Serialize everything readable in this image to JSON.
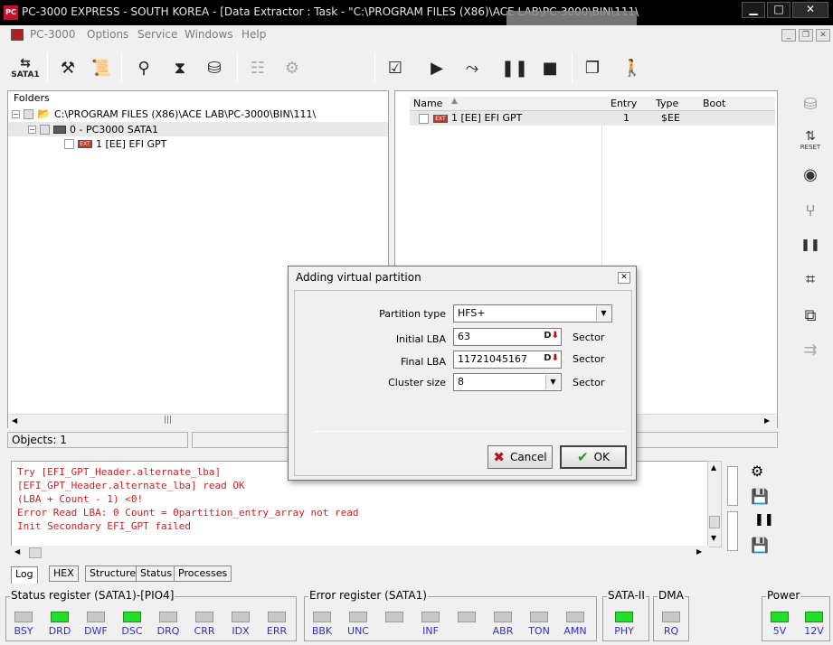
{
  "window": {
    "title": "PC-3000 EXPRESS - SOUTH KOREA - [Data Extractor : Task - \"C:\\PROGRAM FILES (X86)\\ACE LAB\\PC-3000\\BIN\\111\\"
  },
  "menu": [
    "PC-3000",
    "Options",
    "Service",
    "Windows",
    "Help"
  ],
  "toolbar": {
    "sata_label": "SATA1"
  },
  "folders": {
    "header": "Folders",
    "items": [
      {
        "label": "C:\\PROGRAM FILES (X86)\\ACE LAB\\PC-3000\\BIN\\111\\"
      },
      {
        "label": "0 - PC3000 SATA1"
      },
      {
        "label": "1 [EE] EFI GPT"
      }
    ]
  },
  "partitions": {
    "columns": [
      "Name",
      "Entry",
      "Type",
      "Boot"
    ],
    "rows": [
      {
        "name": "1 [EE] EFI GPT",
        "entry": "1",
        "type": "$EE",
        "boot": ""
      }
    ]
  },
  "objects_count": "Objects: 1",
  "dialog": {
    "title": "Adding virtual partition",
    "partition_type_label": "Partition type",
    "partition_type_value": "HFS+",
    "initial_lba_label": "Initial LBA",
    "initial_lba_value": "63",
    "final_lba_label": "Final  LBA",
    "final_lba_value": "11721045167",
    "cluster_size_label": "Cluster size",
    "cluster_size_value": "8",
    "unit": "Sector",
    "cancel_label": "Cancel",
    "ok_label": "OK"
  },
  "log": [
    "Try [EFI_GPT_Header.alternate_lba]",
    "[EFI_GPT_Header.alternate_lba] read OK",
    "(LBA + Count - 1) <0!",
    "Error Read LBA: 0 Count = 0partition_entry_array not read",
    "Init Secondary EFI_GPT failed"
  ],
  "tabs": [
    "Log",
    "HEX",
    "Structure",
    "Status",
    "Processes"
  ],
  "status_register": {
    "title": "Status register (SATA1)-[PIO4]",
    "leds": [
      {
        "label": "BSY",
        "on": false
      },
      {
        "label": "DRD",
        "on": true
      },
      {
        "label": "DWF",
        "on": false
      },
      {
        "label": "DSC",
        "on": true
      },
      {
        "label": "DRQ",
        "on": false
      },
      {
        "label": "CRR",
        "on": false
      },
      {
        "label": "IDX",
        "on": false
      },
      {
        "label": "ERR",
        "on": false
      }
    ]
  },
  "error_register": {
    "title": "Error register (SATA1)",
    "leds": [
      {
        "label": "BBK",
        "on": false
      },
      {
        "label": "UNC",
        "on": false
      },
      {
        "label": "",
        "on": false
      },
      {
        "label": "INF",
        "on": false
      },
      {
        "label": "",
        "on": false
      },
      {
        "label": "ABR",
        "on": false
      },
      {
        "label": "TON",
        "on": false
      },
      {
        "label": "AMN",
        "on": false
      }
    ]
  },
  "sata2": {
    "title": "SATA-II",
    "leds": [
      {
        "label": "PHY",
        "on": true
      }
    ]
  },
  "dma": {
    "title": "DMA",
    "leds": [
      {
        "label": "RQ",
        "on": false
      }
    ]
  },
  "power": {
    "title": "Power",
    "leds": [
      {
        "label": "5V",
        "on": true
      },
      {
        "label": "12V",
        "on": true
      }
    ]
  },
  "colors": {
    "led_on": "#22e02a",
    "log_text": "#d02020",
    "led_label": "#3030c8"
  }
}
